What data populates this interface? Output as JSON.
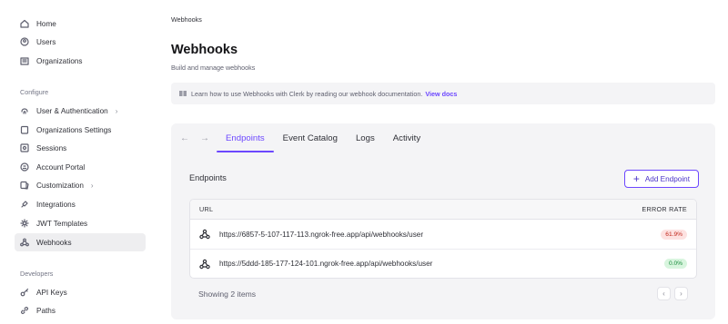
{
  "sidebar": {
    "top_items": [
      {
        "label": "Home",
        "icon": "home-icon"
      },
      {
        "label": "Users",
        "icon": "user-icon"
      },
      {
        "label": "Organizations",
        "icon": "building-icon"
      }
    ],
    "configure_label": "Configure",
    "configure_items": [
      {
        "label": "User & Authentication",
        "icon": "fingerprint-icon",
        "chevron": "›"
      },
      {
        "label": "Organizations Settings",
        "icon": "clipboard-icon"
      },
      {
        "label": "Sessions",
        "icon": "sessions-icon"
      },
      {
        "label": "Account Portal",
        "icon": "portal-icon"
      },
      {
        "label": "Customization",
        "icon": "palette-icon",
        "chevron": "›"
      },
      {
        "label": "Integrations",
        "icon": "plug-icon"
      },
      {
        "label": "JWT Templates",
        "icon": "gear-icon"
      },
      {
        "label": "Webhooks",
        "icon": "webhook-icon",
        "active": true
      }
    ],
    "developers_label": "Developers",
    "developer_items": [
      {
        "label": "API Keys",
        "icon": "key-icon"
      },
      {
        "label": "Paths",
        "icon": "link-icon"
      }
    ]
  },
  "main": {
    "breadcrumb": "Webhooks",
    "title": "Webhooks",
    "subtitle": "Build and manage webhooks",
    "info": {
      "text": "Learn how to use Webhooks with Clerk by reading our webhook documentation.",
      "link": "View docs"
    },
    "tabs": [
      {
        "label": "Endpoints",
        "active": true
      },
      {
        "label": "Event Catalog"
      },
      {
        "label": "Logs"
      },
      {
        "label": "Activity"
      }
    ],
    "nav_back": "←",
    "nav_forward": "→",
    "endpoints_title": "Endpoints",
    "add_button": "Add Endpoint",
    "table": {
      "col_url": "URL",
      "col_error_rate": "ERROR RATE",
      "rows": [
        {
          "url": "https://6857-5-107-117-113.ngrok-free.app/api/webhooks/user",
          "error_rate": "61.9%",
          "status": "red"
        },
        {
          "url": "https://5ddd-185-177-124-101.ngrok-free.app/api/webhooks/user",
          "error_rate": "0.0%",
          "status": "green"
        }
      ]
    },
    "showing": "Showing 2 items",
    "pager_prev": "‹",
    "pager_next": "›"
  },
  "colors": {
    "accent": "#6c47ff",
    "active_bg": "#eeeef0",
    "panel_bg": "#f4f4f6"
  }
}
